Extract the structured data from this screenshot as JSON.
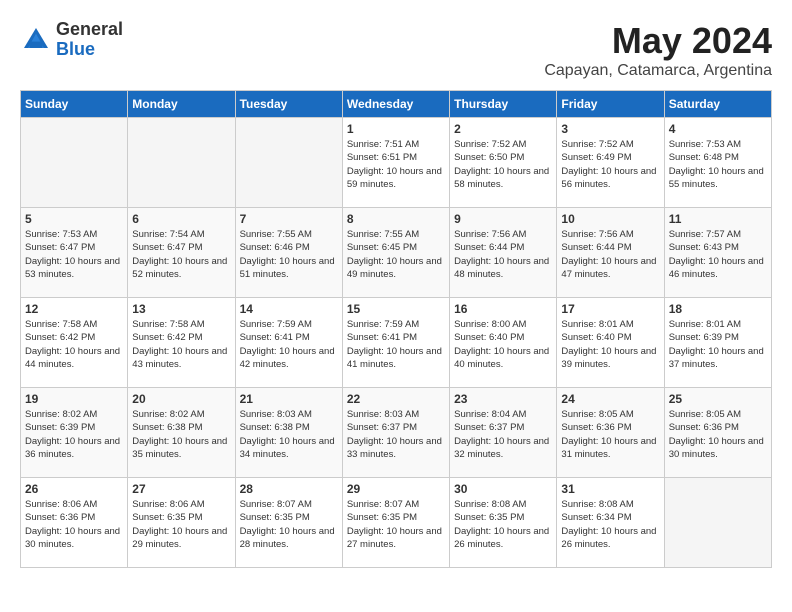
{
  "header": {
    "logo_general": "General",
    "logo_blue": "Blue",
    "month_title": "May 2024",
    "subtitle": "Capayan, Catamarca, Argentina"
  },
  "days_of_week": [
    "Sunday",
    "Monday",
    "Tuesday",
    "Wednesday",
    "Thursday",
    "Friday",
    "Saturday"
  ],
  "weeks": [
    [
      {
        "day": "",
        "empty": true
      },
      {
        "day": "",
        "empty": true
      },
      {
        "day": "",
        "empty": true
      },
      {
        "day": "1",
        "sunrise": "7:51 AM",
        "sunset": "6:51 PM",
        "daylight": "10 hours and 59 minutes."
      },
      {
        "day": "2",
        "sunrise": "7:52 AM",
        "sunset": "6:50 PM",
        "daylight": "10 hours and 58 minutes."
      },
      {
        "day": "3",
        "sunrise": "7:52 AM",
        "sunset": "6:49 PM",
        "daylight": "10 hours and 56 minutes."
      },
      {
        "day": "4",
        "sunrise": "7:53 AM",
        "sunset": "6:48 PM",
        "daylight": "10 hours and 55 minutes."
      }
    ],
    [
      {
        "day": "5",
        "sunrise": "7:53 AM",
        "sunset": "6:47 PM",
        "daylight": "10 hours and 53 minutes."
      },
      {
        "day": "6",
        "sunrise": "7:54 AM",
        "sunset": "6:47 PM",
        "daylight": "10 hours and 52 minutes."
      },
      {
        "day": "7",
        "sunrise": "7:55 AM",
        "sunset": "6:46 PM",
        "daylight": "10 hours and 51 minutes."
      },
      {
        "day": "8",
        "sunrise": "7:55 AM",
        "sunset": "6:45 PM",
        "daylight": "10 hours and 49 minutes."
      },
      {
        "day": "9",
        "sunrise": "7:56 AM",
        "sunset": "6:44 PM",
        "daylight": "10 hours and 48 minutes."
      },
      {
        "day": "10",
        "sunrise": "7:56 AM",
        "sunset": "6:44 PM",
        "daylight": "10 hours and 47 minutes."
      },
      {
        "day": "11",
        "sunrise": "7:57 AM",
        "sunset": "6:43 PM",
        "daylight": "10 hours and 46 minutes."
      }
    ],
    [
      {
        "day": "12",
        "sunrise": "7:58 AM",
        "sunset": "6:42 PM",
        "daylight": "10 hours and 44 minutes."
      },
      {
        "day": "13",
        "sunrise": "7:58 AM",
        "sunset": "6:42 PM",
        "daylight": "10 hours and 43 minutes."
      },
      {
        "day": "14",
        "sunrise": "7:59 AM",
        "sunset": "6:41 PM",
        "daylight": "10 hours and 42 minutes."
      },
      {
        "day": "15",
        "sunrise": "7:59 AM",
        "sunset": "6:41 PM",
        "daylight": "10 hours and 41 minutes."
      },
      {
        "day": "16",
        "sunrise": "8:00 AM",
        "sunset": "6:40 PM",
        "daylight": "10 hours and 40 minutes."
      },
      {
        "day": "17",
        "sunrise": "8:01 AM",
        "sunset": "6:40 PM",
        "daylight": "10 hours and 39 minutes."
      },
      {
        "day": "18",
        "sunrise": "8:01 AM",
        "sunset": "6:39 PM",
        "daylight": "10 hours and 37 minutes."
      }
    ],
    [
      {
        "day": "19",
        "sunrise": "8:02 AM",
        "sunset": "6:39 PM",
        "daylight": "10 hours and 36 minutes."
      },
      {
        "day": "20",
        "sunrise": "8:02 AM",
        "sunset": "6:38 PM",
        "daylight": "10 hours and 35 minutes."
      },
      {
        "day": "21",
        "sunrise": "8:03 AM",
        "sunset": "6:38 PM",
        "daylight": "10 hours and 34 minutes."
      },
      {
        "day": "22",
        "sunrise": "8:03 AM",
        "sunset": "6:37 PM",
        "daylight": "10 hours and 33 minutes."
      },
      {
        "day": "23",
        "sunrise": "8:04 AM",
        "sunset": "6:37 PM",
        "daylight": "10 hours and 32 minutes."
      },
      {
        "day": "24",
        "sunrise": "8:05 AM",
        "sunset": "6:36 PM",
        "daylight": "10 hours and 31 minutes."
      },
      {
        "day": "25",
        "sunrise": "8:05 AM",
        "sunset": "6:36 PM",
        "daylight": "10 hours and 30 minutes."
      }
    ],
    [
      {
        "day": "26",
        "sunrise": "8:06 AM",
        "sunset": "6:36 PM",
        "daylight": "10 hours and 30 minutes."
      },
      {
        "day": "27",
        "sunrise": "8:06 AM",
        "sunset": "6:35 PM",
        "daylight": "10 hours and 29 minutes."
      },
      {
        "day": "28",
        "sunrise": "8:07 AM",
        "sunset": "6:35 PM",
        "daylight": "10 hours and 28 minutes."
      },
      {
        "day": "29",
        "sunrise": "8:07 AM",
        "sunset": "6:35 PM",
        "daylight": "10 hours and 27 minutes."
      },
      {
        "day": "30",
        "sunrise": "8:08 AM",
        "sunset": "6:35 PM",
        "daylight": "10 hours and 26 minutes."
      },
      {
        "day": "31",
        "sunrise": "8:08 AM",
        "sunset": "6:34 PM",
        "daylight": "10 hours and 26 minutes."
      },
      {
        "day": "",
        "empty": true
      }
    ]
  ],
  "labels": {
    "sunrise": "Sunrise:",
    "sunset": "Sunset:",
    "daylight": "Daylight:"
  }
}
